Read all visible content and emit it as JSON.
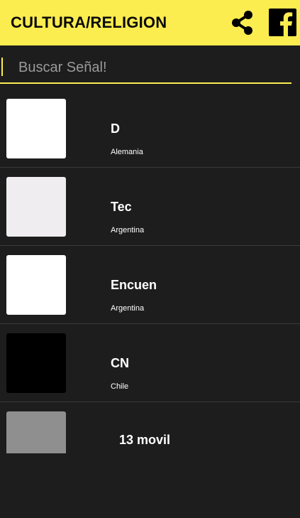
{
  "header": {
    "title": "CULTURA/RELIGION",
    "share_icon": "share-icon",
    "facebook_icon": "facebook-icon",
    "accent_color": "#fbec4f"
  },
  "search": {
    "placeholder": "Buscar Señal!",
    "value": ""
  },
  "channels": [
    {
      "name": "D",
      "country": "Alemania",
      "thumb_color": "#ffffff"
    },
    {
      "name": "Tec",
      "country": "Argentina",
      "thumb_color": "#efedf0"
    },
    {
      "name": "Encuen",
      "country": "Argentina",
      "thumb_color": "#ffffff"
    },
    {
      "name": "CN",
      "country": "Chile",
      "thumb_color": "#000000"
    },
    {
      "name": "13 movil",
      "country": "",
      "thumb_color": "#8f8f8f"
    }
  ]
}
